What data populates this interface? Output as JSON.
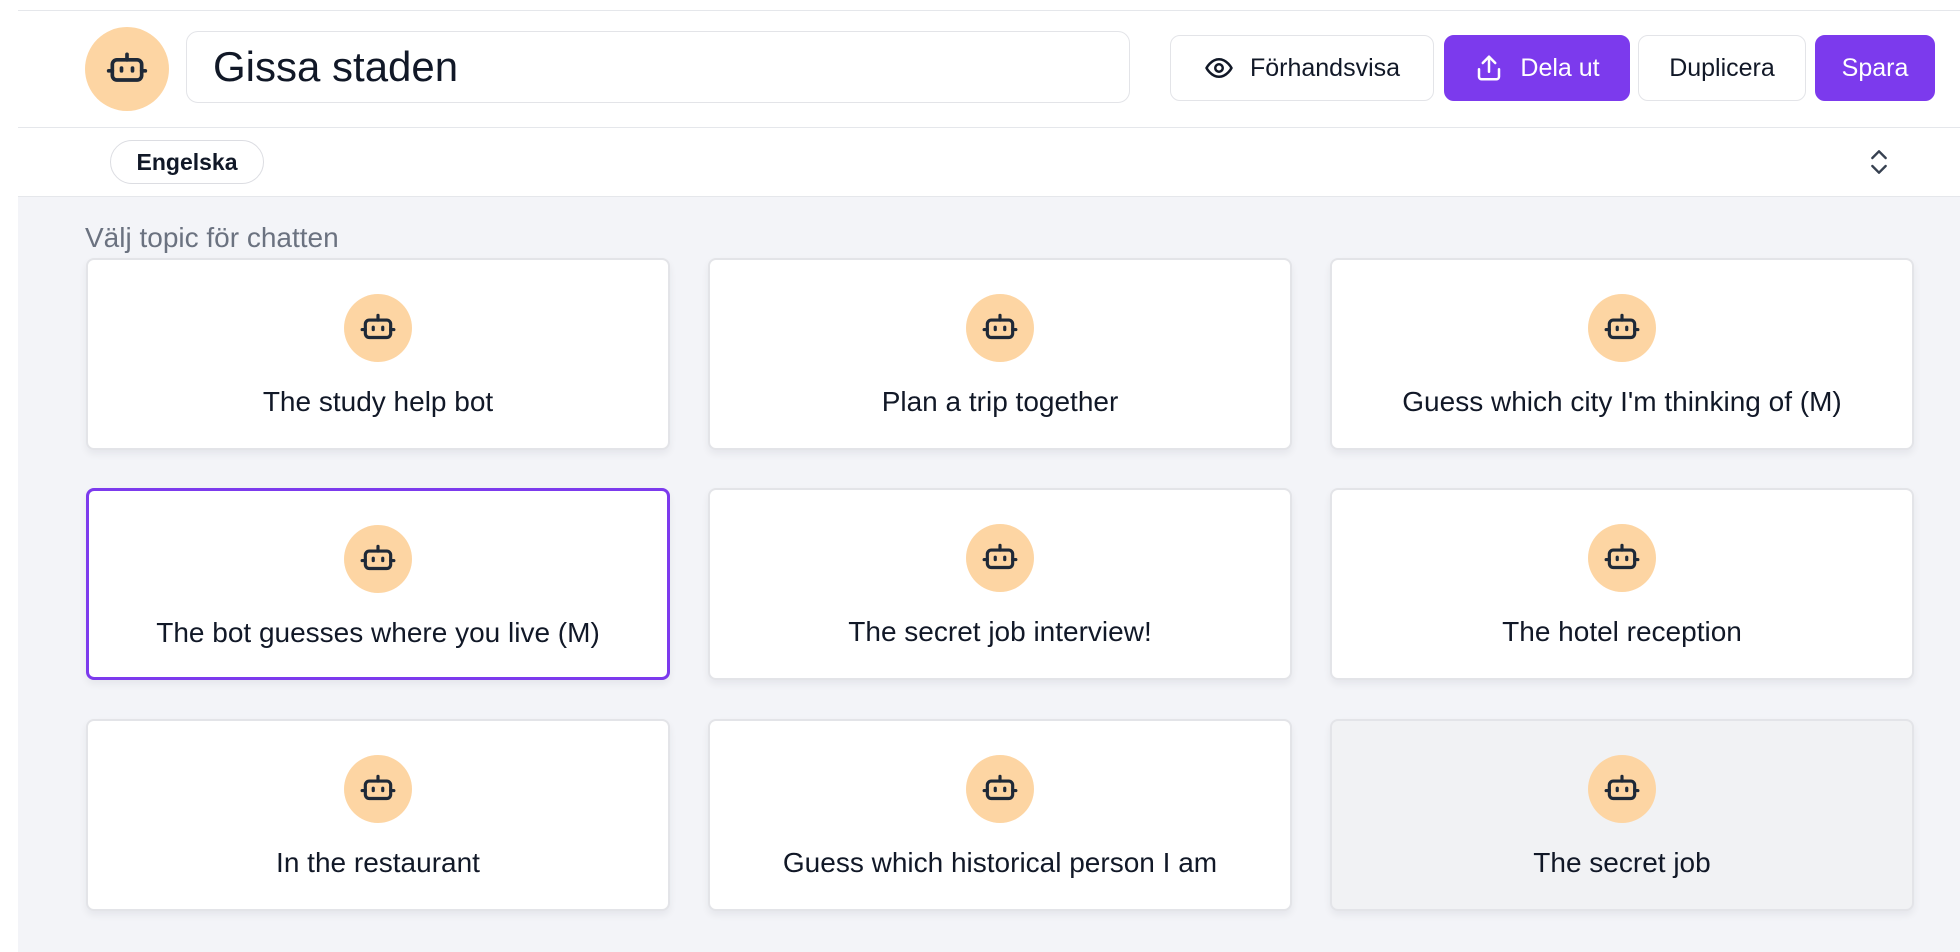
{
  "header": {
    "title_value": "Gissa staden",
    "preview_label": "Förhandsvisa",
    "share_label": "Dela ut",
    "duplicate_label": "Duplicera",
    "save_label": "Spara",
    "avatar_icon": "robot-icon"
  },
  "language": {
    "selected": "Engelska",
    "sort_icon": "chevron-up-down-icon"
  },
  "topics": {
    "label": "Välj topic för chatten",
    "items": [
      {
        "label": "The study help bot",
        "icon": "robot-icon"
      },
      {
        "label": "Plan a trip together",
        "icon": "robot-icon"
      },
      {
        "label": "Guess which city I'm thinking of (M)",
        "icon": "robot-icon"
      },
      {
        "label": "The bot guesses where you live (M)",
        "icon": "robot-icon",
        "selected": true
      },
      {
        "label": "The secret job interview!",
        "icon": "robot-icon"
      },
      {
        "label": "The hotel reception",
        "icon": "robot-icon"
      },
      {
        "label": "In the restaurant",
        "icon": "robot-icon"
      },
      {
        "label": "Guess which historical person I am",
        "icon": "robot-icon"
      },
      {
        "label": "The secret job",
        "icon": "robot-icon",
        "hovered": true
      }
    ]
  },
  "colors": {
    "accent": "#7c3aed",
    "avatar_bg": "#fdd5a3",
    "background": "#f3f4f8",
    "card_border": "#e3e4e8"
  }
}
